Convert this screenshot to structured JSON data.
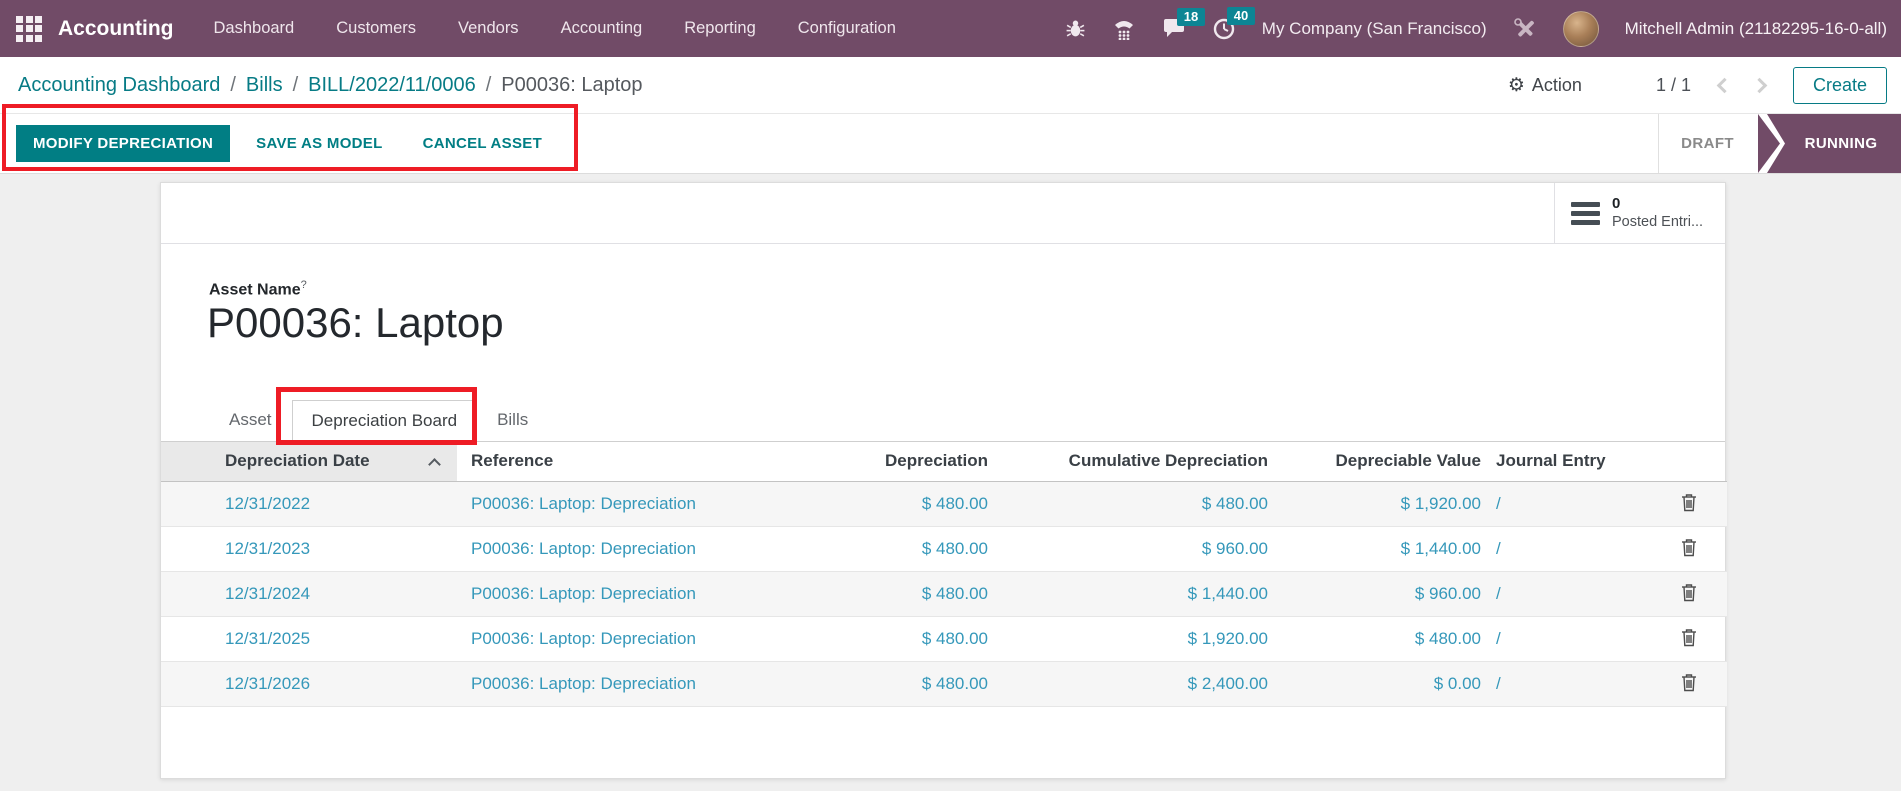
{
  "topbar": {
    "brand": "Accounting",
    "menus": [
      "Dashboard",
      "Customers",
      "Vendors",
      "Accounting",
      "Reporting",
      "Configuration"
    ],
    "badges": {
      "messages": "18",
      "activities": "40"
    },
    "company": "My Company (San Francisco)",
    "user": "Mitchell Admin (21182295-16-0-all)"
  },
  "breadcrumb": {
    "links": [
      "Accounting Dashboard",
      "Bills",
      "BILL/2022/11/0006"
    ],
    "separator": "/",
    "current": "P00036: Laptop"
  },
  "controls": {
    "action_label": "Action",
    "pager": "1 / 1",
    "create_label": "Create"
  },
  "action_bar": {
    "buttons": [
      "MODIFY DEPRECIATION",
      "SAVE AS MODEL",
      "CANCEL ASSET"
    ],
    "statuses": [
      "DRAFT",
      "RUNNING"
    ],
    "active_status": "RUNNING"
  },
  "form": {
    "smart_button": {
      "count": "0",
      "label": "Posted Entri..."
    },
    "asset_name_label": "Asset Name",
    "help_mark": "?",
    "title": "P00036: Laptop",
    "tabs": [
      {
        "label": "Asset",
        "active": false
      },
      {
        "label": "Depreciation Board",
        "active": true
      },
      {
        "label": "Bills",
        "active": false
      }
    ]
  },
  "table": {
    "columns": [
      "Depreciation Date",
      "Reference",
      "Depreciation",
      "Cumulative Depreciation",
      "Depreciable Value",
      "Journal Entry"
    ],
    "sort": {
      "column": "Depreciation Date",
      "direction": "asc"
    },
    "rows": [
      {
        "date": "12/31/2022",
        "reference": "P00036: Laptop: Depreciation",
        "depreciation": "$ 480.00",
        "cumulative": "$ 480.00",
        "depreciable": "$ 1,920.00",
        "journal": "/"
      },
      {
        "date": "12/31/2023",
        "reference": "P00036: Laptop: Depreciation",
        "depreciation": "$ 480.00",
        "cumulative": "$ 960.00",
        "depreciable": "$ 1,440.00",
        "journal": "/"
      },
      {
        "date": "12/31/2024",
        "reference": "P00036: Laptop: Depreciation",
        "depreciation": "$ 480.00",
        "cumulative": "$ 1,440.00",
        "depreciable": "$ 960.00",
        "journal": "/"
      },
      {
        "date": "12/31/2025",
        "reference": "P00036: Laptop: Depreciation",
        "depreciation": "$ 480.00",
        "cumulative": "$ 1,920.00",
        "depreciable": "$ 480.00",
        "journal": "/"
      },
      {
        "date": "12/31/2026",
        "reference": "P00036: Laptop: Depreciation",
        "depreciation": "$ 480.00",
        "cumulative": "$ 2,400.00",
        "depreciable": "$ 0.00",
        "journal": "/"
      }
    ]
  },
  "colors": {
    "topbar_purple": "#714b67",
    "accent_teal": "#017e84",
    "table_link_blue": "#3598ba",
    "badge_teal": "#0c8594",
    "annotation_red": "#ee1c25",
    "status_active_purple": "#714b67"
  }
}
